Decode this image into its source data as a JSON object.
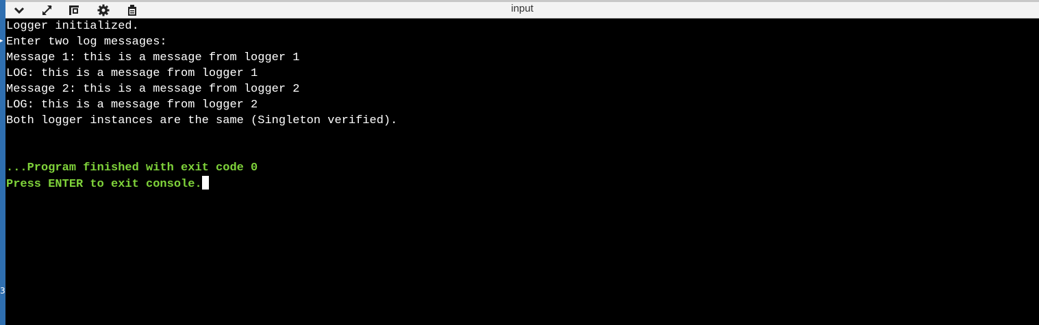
{
  "toolbar": {
    "title": "input",
    "buttons": [
      {
        "name": "chevron-down-icon"
      },
      {
        "name": "expand-icon"
      },
      {
        "name": "layout-icon"
      },
      {
        "name": "gear-icon"
      },
      {
        "name": "clipboard-icon"
      }
    ]
  },
  "left_strip": {
    "marker_top": "▸",
    "marker_bottom": "3"
  },
  "console": {
    "lines": [
      "Logger initialized.",
      "Enter two log messages:",
      "Message 1: this is a message from logger 1",
      "LOG: this is a message from logger 1",
      "Message 2: this is a message from logger 2",
      "LOG: this is a message from logger 2",
      "Both logger instances are the same (Singleton verified).",
      "",
      "",
      "...Program finished with exit code 0",
      "Press ENTER to exit console."
    ],
    "colors": {
      "normal": "#ffffff",
      "status": "#7fd33a",
      "background": "#000000"
    }
  }
}
